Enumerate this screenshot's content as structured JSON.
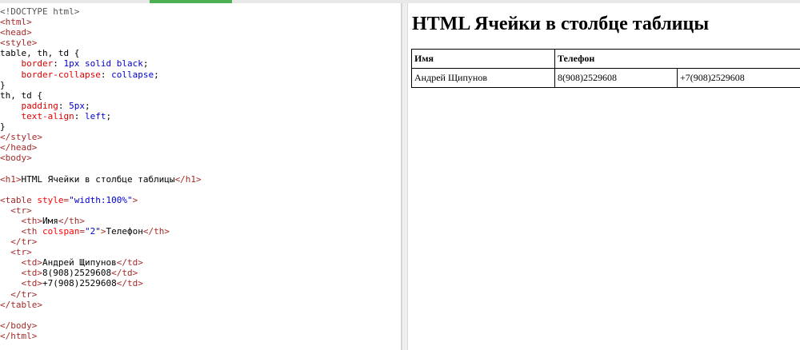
{
  "editor": {
    "lines": [
      [
        [
          "t-doctype",
          "<!DOCTYPE html>"
        ]
      ],
      [
        [
          "t-tag",
          "<html>"
        ]
      ],
      [
        [
          "t-tag",
          "<head>"
        ]
      ],
      [
        [
          "t-tag",
          "<style>"
        ]
      ],
      [
        [
          "t-text",
          "table, th, td {"
        ]
      ],
      [
        [
          "t-text",
          "    "
        ],
        [
          "t-prop",
          "border"
        ],
        [
          "t-text",
          ": "
        ],
        [
          "t-val",
          "1px solid black"
        ],
        [
          "t-text",
          ";"
        ]
      ],
      [
        [
          "t-text",
          "    "
        ],
        [
          "t-prop",
          "border-collapse"
        ],
        [
          "t-text",
          ": "
        ],
        [
          "t-val",
          "collapse"
        ],
        [
          "t-text",
          ";"
        ]
      ],
      [
        [
          "t-text",
          "}"
        ]
      ],
      [
        [
          "t-text",
          "th, td {"
        ]
      ],
      [
        [
          "t-text",
          "    "
        ],
        [
          "t-prop",
          "padding"
        ],
        [
          "t-text",
          ": "
        ],
        [
          "t-val",
          "5px"
        ],
        [
          "t-text",
          ";"
        ]
      ],
      [
        [
          "t-text",
          "    "
        ],
        [
          "t-prop",
          "text-align"
        ],
        [
          "t-text",
          ": "
        ],
        [
          "t-val",
          "left"
        ],
        [
          "t-text",
          ";"
        ]
      ],
      [
        [
          "t-text",
          "}"
        ]
      ],
      [
        [
          "t-tag",
          "</style>"
        ]
      ],
      [
        [
          "t-tag",
          "</head>"
        ]
      ],
      [
        [
          "t-tag",
          "<body>"
        ]
      ],
      [
        [
          "t-text",
          ""
        ]
      ],
      [
        [
          "t-tag",
          "<h1>"
        ],
        [
          "t-text",
          "HTML Ячейки в столбце таблицы"
        ],
        [
          "t-tag",
          "</h1>"
        ]
      ],
      [
        [
          "t-text",
          ""
        ]
      ],
      [
        [
          "t-tag",
          "<table "
        ],
        [
          "t-attr",
          "style"
        ],
        [
          "t-tag",
          "="
        ],
        [
          "t-str",
          "\"width:100%\""
        ],
        [
          "t-tag",
          ">"
        ]
      ],
      [
        [
          "t-text",
          "  "
        ],
        [
          "t-tag",
          "<tr>"
        ]
      ],
      [
        [
          "t-text",
          "    "
        ],
        [
          "t-tag",
          "<th>"
        ],
        [
          "t-text",
          "Имя"
        ],
        [
          "t-tag",
          "</th>"
        ]
      ],
      [
        [
          "t-text",
          "    "
        ],
        [
          "t-tag",
          "<th "
        ],
        [
          "t-attr",
          "colspan"
        ],
        [
          "t-tag",
          "="
        ],
        [
          "t-str",
          "\"2\""
        ],
        [
          "t-tag",
          ">"
        ],
        [
          "t-text",
          "Телефон"
        ],
        [
          "t-tag",
          "</th>"
        ]
      ],
      [
        [
          "t-text",
          "  "
        ],
        [
          "t-tag",
          "</tr>"
        ]
      ],
      [
        [
          "t-text",
          "  "
        ],
        [
          "t-tag",
          "<tr>"
        ]
      ],
      [
        [
          "t-text",
          "    "
        ],
        [
          "t-tag",
          "<td>"
        ],
        [
          "t-text",
          "Андрей Щипунов"
        ],
        [
          "t-tag",
          "</td>"
        ]
      ],
      [
        [
          "t-text",
          "    "
        ],
        [
          "t-tag",
          "<td>"
        ],
        [
          "t-text",
          "8(908)2529608"
        ],
        [
          "t-tag",
          "</td>"
        ]
      ],
      [
        [
          "t-text",
          "    "
        ],
        [
          "t-tag",
          "<td>"
        ],
        [
          "t-text",
          "+7(908)2529608"
        ],
        [
          "t-tag",
          "</td>"
        ]
      ],
      [
        [
          "t-text",
          "  "
        ],
        [
          "t-tag",
          "</tr>"
        ]
      ],
      [
        [
          "t-tag",
          "</table>"
        ]
      ],
      [
        [
          "t-text",
          ""
        ]
      ],
      [
        [
          "t-tag",
          "</body>"
        ]
      ],
      [
        [
          "t-tag",
          "</html>"
        ]
      ]
    ]
  },
  "preview": {
    "heading": "HTML Ячейки в столбце таблицы",
    "table": {
      "header": {
        "name": "Имя",
        "phone": "Телефон"
      },
      "row": {
        "name": "Андрей Щипунов",
        "phone1": "8(908)2529608",
        "phone2": "+7(908)2529608"
      }
    }
  }
}
